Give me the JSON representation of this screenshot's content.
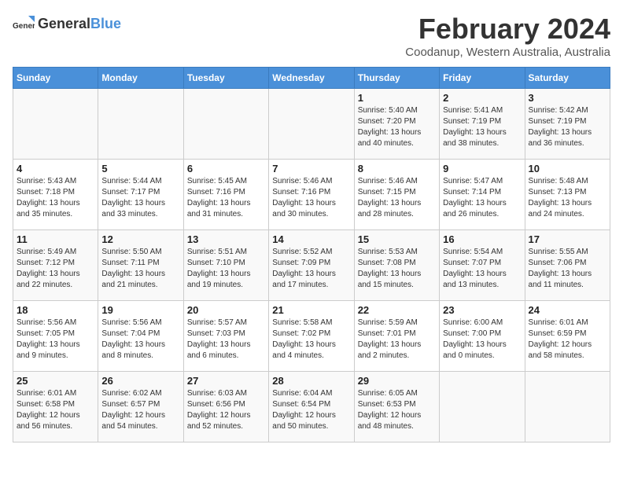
{
  "logo": {
    "general": "General",
    "blue": "Blue"
  },
  "title": "February 2024",
  "subtitle": "Coodanup, Western Australia, Australia",
  "days_of_week": [
    "Sunday",
    "Monday",
    "Tuesday",
    "Wednesday",
    "Thursday",
    "Friday",
    "Saturday"
  ],
  "weeks": [
    [
      {
        "day": "",
        "info": ""
      },
      {
        "day": "",
        "info": ""
      },
      {
        "day": "",
        "info": ""
      },
      {
        "day": "",
        "info": ""
      },
      {
        "day": "1",
        "info": "Sunrise: 5:40 AM\nSunset: 7:20 PM\nDaylight: 13 hours\nand 40 minutes."
      },
      {
        "day": "2",
        "info": "Sunrise: 5:41 AM\nSunset: 7:19 PM\nDaylight: 13 hours\nand 38 minutes."
      },
      {
        "day": "3",
        "info": "Sunrise: 5:42 AM\nSunset: 7:19 PM\nDaylight: 13 hours\nand 36 minutes."
      }
    ],
    [
      {
        "day": "4",
        "info": "Sunrise: 5:43 AM\nSunset: 7:18 PM\nDaylight: 13 hours\nand 35 minutes."
      },
      {
        "day": "5",
        "info": "Sunrise: 5:44 AM\nSunset: 7:17 PM\nDaylight: 13 hours\nand 33 minutes."
      },
      {
        "day": "6",
        "info": "Sunrise: 5:45 AM\nSunset: 7:16 PM\nDaylight: 13 hours\nand 31 minutes."
      },
      {
        "day": "7",
        "info": "Sunrise: 5:46 AM\nSunset: 7:16 PM\nDaylight: 13 hours\nand 30 minutes."
      },
      {
        "day": "8",
        "info": "Sunrise: 5:46 AM\nSunset: 7:15 PM\nDaylight: 13 hours\nand 28 minutes."
      },
      {
        "day": "9",
        "info": "Sunrise: 5:47 AM\nSunset: 7:14 PM\nDaylight: 13 hours\nand 26 minutes."
      },
      {
        "day": "10",
        "info": "Sunrise: 5:48 AM\nSunset: 7:13 PM\nDaylight: 13 hours\nand 24 minutes."
      }
    ],
    [
      {
        "day": "11",
        "info": "Sunrise: 5:49 AM\nSunset: 7:12 PM\nDaylight: 13 hours\nand 22 minutes."
      },
      {
        "day": "12",
        "info": "Sunrise: 5:50 AM\nSunset: 7:11 PM\nDaylight: 13 hours\nand 21 minutes."
      },
      {
        "day": "13",
        "info": "Sunrise: 5:51 AM\nSunset: 7:10 PM\nDaylight: 13 hours\nand 19 minutes."
      },
      {
        "day": "14",
        "info": "Sunrise: 5:52 AM\nSunset: 7:09 PM\nDaylight: 13 hours\nand 17 minutes."
      },
      {
        "day": "15",
        "info": "Sunrise: 5:53 AM\nSunset: 7:08 PM\nDaylight: 13 hours\nand 15 minutes."
      },
      {
        "day": "16",
        "info": "Sunrise: 5:54 AM\nSunset: 7:07 PM\nDaylight: 13 hours\nand 13 minutes."
      },
      {
        "day": "17",
        "info": "Sunrise: 5:55 AM\nSunset: 7:06 PM\nDaylight: 13 hours\nand 11 minutes."
      }
    ],
    [
      {
        "day": "18",
        "info": "Sunrise: 5:56 AM\nSunset: 7:05 PM\nDaylight: 13 hours\nand 9 minutes."
      },
      {
        "day": "19",
        "info": "Sunrise: 5:56 AM\nSunset: 7:04 PM\nDaylight: 13 hours\nand 8 minutes."
      },
      {
        "day": "20",
        "info": "Sunrise: 5:57 AM\nSunset: 7:03 PM\nDaylight: 13 hours\nand 6 minutes."
      },
      {
        "day": "21",
        "info": "Sunrise: 5:58 AM\nSunset: 7:02 PM\nDaylight: 13 hours\nand 4 minutes."
      },
      {
        "day": "22",
        "info": "Sunrise: 5:59 AM\nSunset: 7:01 PM\nDaylight: 13 hours\nand 2 minutes."
      },
      {
        "day": "23",
        "info": "Sunrise: 6:00 AM\nSunset: 7:00 PM\nDaylight: 13 hours\nand 0 minutes."
      },
      {
        "day": "24",
        "info": "Sunrise: 6:01 AM\nSunset: 6:59 PM\nDaylight: 12 hours\nand 58 minutes."
      }
    ],
    [
      {
        "day": "25",
        "info": "Sunrise: 6:01 AM\nSunset: 6:58 PM\nDaylight: 12 hours\nand 56 minutes."
      },
      {
        "day": "26",
        "info": "Sunrise: 6:02 AM\nSunset: 6:57 PM\nDaylight: 12 hours\nand 54 minutes."
      },
      {
        "day": "27",
        "info": "Sunrise: 6:03 AM\nSunset: 6:56 PM\nDaylight: 12 hours\nand 52 minutes."
      },
      {
        "day": "28",
        "info": "Sunrise: 6:04 AM\nSunset: 6:54 PM\nDaylight: 12 hours\nand 50 minutes."
      },
      {
        "day": "29",
        "info": "Sunrise: 6:05 AM\nSunset: 6:53 PM\nDaylight: 12 hours\nand 48 minutes."
      },
      {
        "day": "",
        "info": ""
      },
      {
        "day": "",
        "info": ""
      }
    ]
  ]
}
